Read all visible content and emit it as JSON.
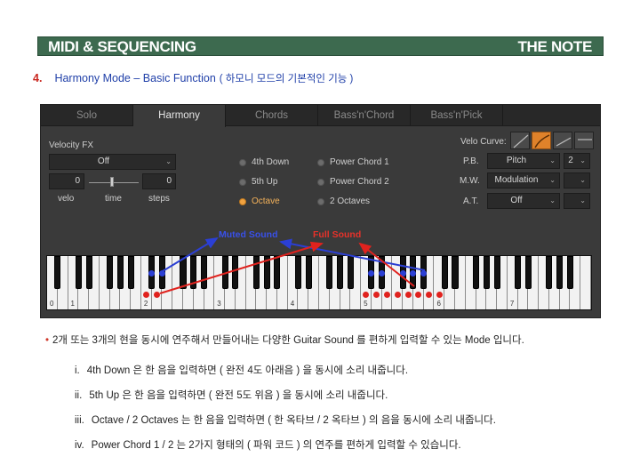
{
  "header": {
    "left_title": "MIDI & SEQUENCING",
    "right_title": "THE NOTE",
    "bg_color": "#3d6a4f"
  },
  "section": {
    "number": "4.",
    "title": "Harmony Mode – Basic Function",
    "subtitle": "( 하모니 모드의 기본적인 기능 )"
  },
  "plugin": {
    "tabs": [
      "Solo",
      "Harmony",
      "Chords",
      "Bass'n'Chord",
      "Bass'n'Pick"
    ],
    "active_tab": "Harmony",
    "velocity_fx": {
      "label": "Velocity FX",
      "mode": "Off",
      "velo_value": "0",
      "steps_value": "0",
      "velo_label": "velo",
      "time_label": "time",
      "steps_label": "steps"
    },
    "harmony_options": [
      {
        "label": "4th Down",
        "selected": false
      },
      {
        "label": "5th Up",
        "selected": false
      },
      {
        "label": "Octave",
        "selected": true
      },
      {
        "label": "Power Chord 1",
        "selected": false
      },
      {
        "label": "Power Chord 2",
        "selected": false
      },
      {
        "label": "2 Octaves",
        "selected": false
      }
    ],
    "velo_curve": {
      "label": "Velo Curve:",
      "options": [
        "linear-curve",
        "exp-curve",
        "log-curve",
        "flat-curve"
      ],
      "active_index": 1
    },
    "routing": {
      "pb_label": "P.B.",
      "pb_value": "Pitch",
      "pb_range": "2",
      "mw_label": "M.W.",
      "mw_value": "Modulation",
      "at_label": "A.T.",
      "at_value": "Off"
    },
    "accent_color": "#f2a340"
  },
  "keyboard": {
    "octave_labels": [
      "0",
      "1",
      "2",
      "3",
      "4",
      "5",
      "6",
      "7"
    ],
    "muted_label": "Muted Sound",
    "full_label": "Full Sound",
    "muted_color": "#2b3fd4",
    "full_color": "#e0221e"
  },
  "bullet": {
    "text": "2개 또는 3개의 현을 동시에 연주해서 만들어내는 다양한 Guitar Sound 를 편하게 입력할 수 있는 Mode 입니다."
  },
  "items": [
    {
      "num": "i.",
      "text": "4th Down 은 한 음을 입력하면 ( 완전 4도 아래음 ) 을 동시에 소리 내줍니다."
    },
    {
      "num": "ii.",
      "text": "5th Up 은 한 음을 입력하면 ( 완전 5도 위음 ) 을 동시에 소리 내줍니다."
    },
    {
      "num": "iii.",
      "text": "Octave / 2 Octaves 는 한 음을 입력하면 ( 한 옥타브 / 2 옥타브 ) 의 음을 동시에 소리 내줍니다."
    },
    {
      "num": "iv.",
      "text": "Power Chord 1 / 2 는 2가지 형태의 ( 파워 코드 ) 의 연주를 편하게 입력할 수 있습니다."
    }
  ]
}
